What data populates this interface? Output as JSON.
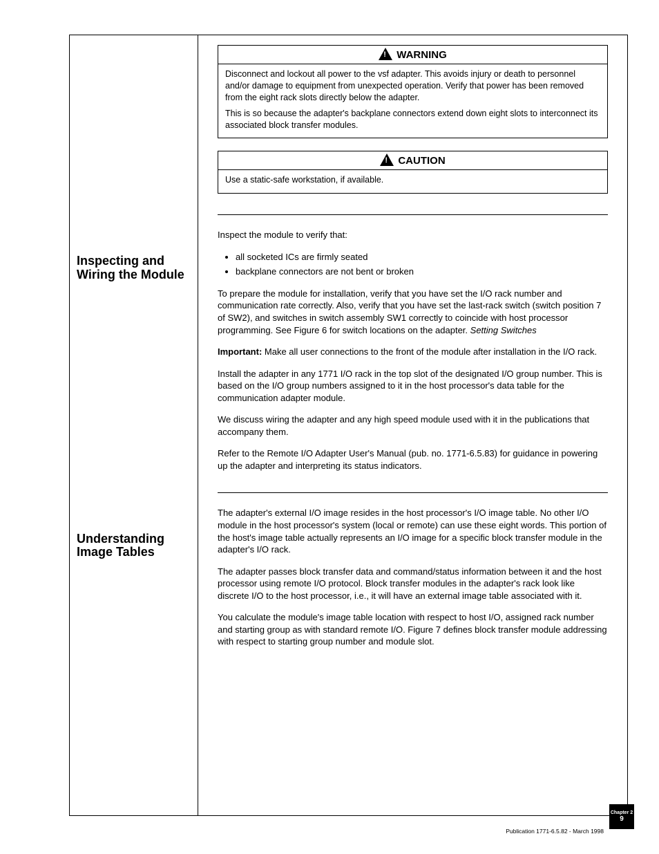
{
  "sidebar": {
    "head1_l1": "Inspecting and",
    "head1_l2": "Wiring the Module",
    "head2_l1": "Understanding",
    "head2_l2": "Image Tables"
  },
  "notices": {
    "warn_label": "WARNING",
    "caution_label": "CAUTION",
    "warn_text1": "Disconnect and lockout all power to the vsf adapter. This avoids injury or death to personnel and/or damage to equipment from unexpected operation. Verify that power has been removed from the eight rack slots directly below the adapter.",
    "warn_text2": "This is so because the adapter's backplane connectors extend down eight slots to interconnect its associated block transfer modules.",
    "caution_text": "Use a static-safe workstation, if available."
  },
  "s1": {
    "intro": "Inspect the module to verify that:",
    "bullets": [
      "all socketed ICs are firmly seated",
      "backplane connectors are not bent or broken"
    ],
    "p2a": "To prepare the module for installation, verify that you have set the I/O rack number and communication rate correctly. Also, verify that you have set the last-rack switch (switch position 7 of SW2), and switches in switch assembly SW1 correctly to coincide with host processor programming. See Figure 6 for switch locations on the adapter.",
    "p2b": "Setting Switches",
    "p3_bold": "Important:",
    "p3_rest": " Make all user connections to the front of the module after installation in the I/O rack.",
    "p4": "Install the adapter in any 1771 I/O rack in the top slot of the designated I/O group number. This is based on the I/O group numbers assigned to it in the host processor's data table for the communication adapter module.",
    "p5": "We discuss wiring the adapter and any high speed module used with it in the publications that accompany them.",
    "p6": "Refer to the Remote I/O Adapter User's Manual (pub. no. 1771-6.5.83) for guidance in powering up the adapter and interpreting its status indicators."
  },
  "s2": {
    "p1": "The adapter's external I/O image resides in the host processor's I/O image table. No other I/O module in the host processor's system (local or remote) can use these eight words. This portion of the host's image table actually represents an I/O image for a specific block transfer module in the adapter's I/O rack.",
    "p2": "The adapter passes block transfer data and command/status information between it and the host processor using remote I/O protocol. Block transfer modules in the adapter's rack look like discrete I/O to the host processor, i.e., it will have an external image table associated with it.",
    "p3": "You calculate the module's image table location with respect to host I/O, assigned rack number and starting group as with standard remote I/O. Figure 7 defines block transfer module addressing with respect to starting group number and module slot."
  },
  "footer": {
    "left": "Publication 1771-6.5.82 - March 1998",
    "pagenum": "9",
    "chapter": "Chapter 2"
  }
}
